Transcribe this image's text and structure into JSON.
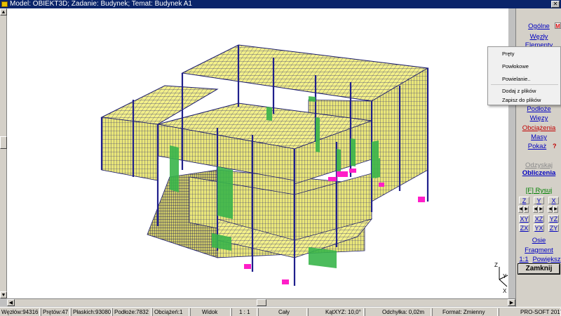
{
  "window": {
    "title": "Model: OBIEKT3D; Zadanie: Budynek; Temat: Budynek A1"
  },
  "side_panel": {
    "items": [
      {
        "label": "Ogólne"
      },
      {
        "label": "Węzły"
      },
      {
        "label": "Elementy"
      },
      {
        "label": "Podłoże"
      },
      {
        "label": "Więzy"
      },
      {
        "label": "Obciążenia"
      },
      {
        "label": "Masy"
      },
      {
        "label": "Pokaż"
      },
      {
        "label": "Odzyskaj"
      },
      {
        "label": "Obliczenia"
      },
      {
        "label": "[F] Rysuj"
      },
      {
        "label": "Osie"
      },
      {
        "label": "Fragment"
      },
      {
        "label": "1:1"
      },
      {
        "label": "Powiększ"
      }
    ],
    "help": "?",
    "marker": "M",
    "view_buttons": {
      "row1": [
        "Z",
        "Y",
        "X"
      ],
      "row2": [
        "XY",
        "XZ",
        "YZ"
      ],
      "row3": [
        "ZX",
        "YX",
        "ZY"
      ]
    },
    "close_label": "Zamknij"
  },
  "context_menu": {
    "items": [
      "Pręty",
      "Powłokowe",
      "Powielanie..",
      "Dodaj z plików",
      "Zapisz do plików"
    ]
  },
  "axes": {
    "z": "Z",
    "y": "Y",
    "x": "X"
  },
  "status_bar": {
    "nodes": "Węzłów:94316",
    "bars": "Prętów:47",
    "planars": "Płaskich:93080",
    "subsoil": "Podłoże:7832",
    "loads": "Obciążeń:1",
    "view": "Widok",
    "scale": "1 : 1",
    "range": "Cały",
    "angle": "KątXYZ: 10,0°",
    "deviation": "Odchyłka: 0,02m",
    "format": "Format: Zmienny",
    "vendor": "PRO-SOFT 2017"
  },
  "colors": {
    "slab_fill": "#f3f08a",
    "mesh_line": "#1a1a6e",
    "column": "#1f1f8c",
    "wall_green": "#39b54a",
    "support_magenta": "#ff1ec8",
    "title_bg": "#0a246a"
  }
}
